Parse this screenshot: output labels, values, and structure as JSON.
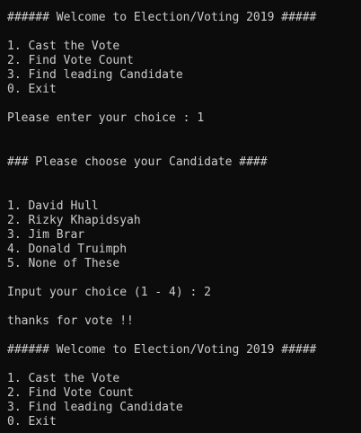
{
  "lines": {
    "welcome_banner_1": "###### Welcome to Election/Voting 2019 #####",
    "menu_1": [
      "1. Cast the Vote",
      "2. Find Vote Count",
      "3. Find leading Candidate",
      "0. Exit"
    ],
    "choice_prompt": "Please enter your choice : 1",
    "candidate_header": "### Please choose your Candidate ####",
    "candidates": [
      "1. David Hull",
      "2. Rizky Khapidsyah",
      "3. Jim Brar",
      "4. Donald Truimph",
      "5. None of These"
    ],
    "vote_prompt": "Input your choice (1 - 4) : 2",
    "thanks_message": "thanks for vote !!",
    "welcome_banner_2": "###### Welcome to Election/Voting 2019 #####",
    "menu_2": [
      "1. Cast the Vote",
      "2. Find Vote Count",
      "3. Find leading Candidate",
      "0. Exit"
    ]
  },
  "colors": {
    "background": "#0c0c0c",
    "text": "#cccccc"
  }
}
